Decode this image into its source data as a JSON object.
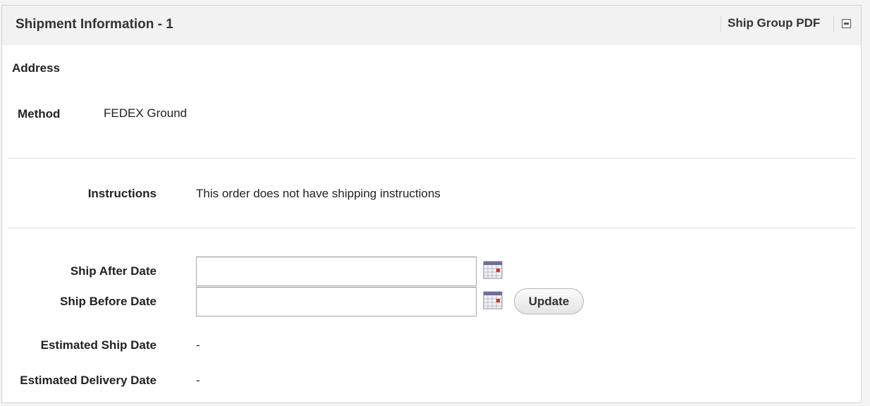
{
  "panel": {
    "title": "Shipment Information - 1",
    "pdf_link": "Ship Group PDF",
    "collapse_icon": "collapse-icon"
  },
  "address": {
    "label": "Address"
  },
  "method": {
    "label": "Method",
    "value": "FEDEX Ground"
  },
  "instructions": {
    "label": "Instructions",
    "value": "This order does not have shipping instructions"
  },
  "ship_after": {
    "label": "Ship After Date",
    "value": "",
    "icon": "calendar-icon"
  },
  "ship_before": {
    "label": "Ship Before Date",
    "value": "",
    "icon": "calendar-icon"
  },
  "update_button": "Update",
  "estimated_ship": {
    "label": "Estimated Ship Date",
    "value": "-"
  },
  "estimated_delivery": {
    "label": "Estimated Delivery Date",
    "value": "-"
  }
}
